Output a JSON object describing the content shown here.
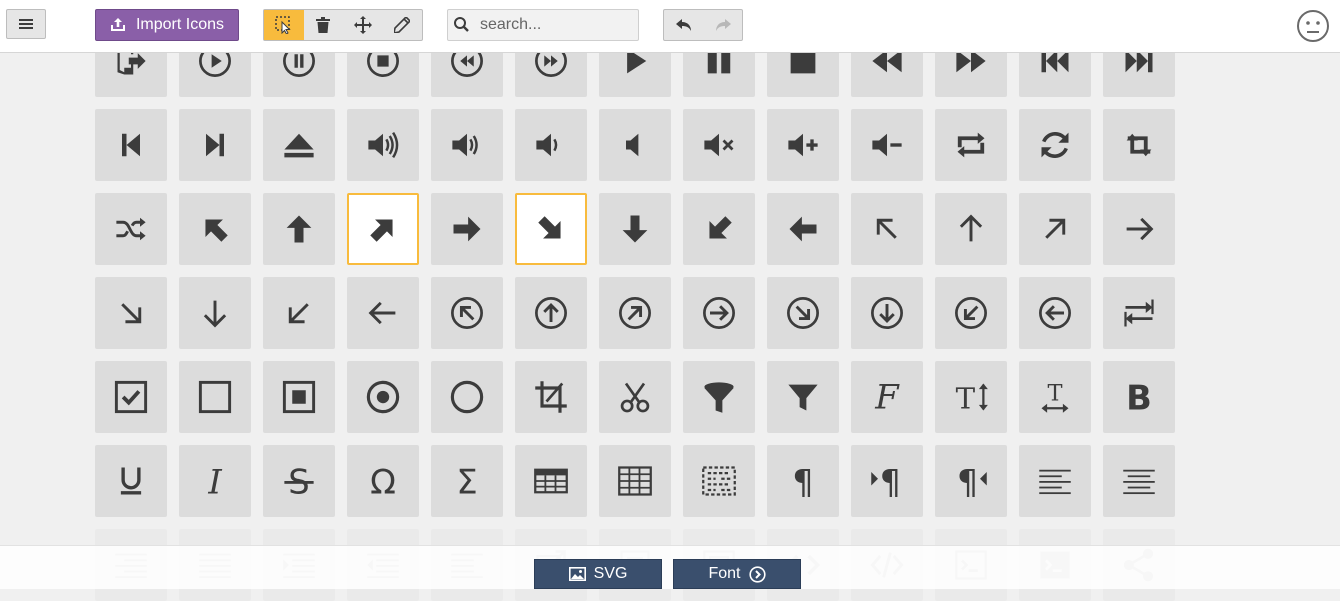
{
  "toolbar": {
    "import_label": "Import Icons",
    "search_placeholder": "search...",
    "menu_icon": "hamburger-icon",
    "tools": [
      "select-icon",
      "trash-icon",
      "move-icon",
      "pencil-icon"
    ],
    "undo_icons": [
      "undo-icon",
      "redo-icon"
    ],
    "status_icon": "neutral-face-icon"
  },
  "colors": {
    "accent": "#f8bb3d",
    "import": "#8a5fa8",
    "download": "#3a4f6d",
    "tile": "#dcdcdc",
    "glyph": "#3c3c3c"
  },
  "icons": [
    [
      "exit-icon",
      "play-circle-icon",
      "pause-circle-icon",
      "stop-circle-icon",
      "backward-circle-icon",
      "forward-circle-icon",
      "play-icon",
      "pause-icon",
      "stop-icon",
      "backward-icon",
      "forward-icon",
      "first-icon",
      "last-icon"
    ],
    [
      "previous-icon",
      "next-icon",
      "eject-icon",
      "volume-high-icon",
      "volume-medium-icon",
      "volume-low-icon",
      "volume-mute-icon",
      "volume-mute2-icon",
      "volume-increase-icon",
      "volume-decrease-icon",
      "loop-icon",
      "loop2-icon",
      "infinite-icon"
    ],
    [
      "shuffle-icon",
      "arrow-up-left-icon",
      "arrow-up-icon",
      "arrow-up-right-icon",
      "arrow-right-icon",
      "arrow-down-right-icon",
      "arrow-down-icon",
      "arrow-down-left-icon",
      "arrow-left-icon",
      "arrow-up-left2-icon",
      "arrow-up2-icon",
      "arrow-up-right2-icon",
      "arrow-right2-icon"
    ],
    [
      "arrow-down-right2-icon",
      "arrow-down2-icon",
      "arrow-down-left2-icon",
      "arrow-left2-icon",
      "circle-up-left-icon",
      "circle-up-icon",
      "circle-up-right-icon",
      "circle-right-icon",
      "circle-down-right-icon",
      "circle-down-icon",
      "circle-down-left-icon",
      "circle-left-icon",
      "tab-icon"
    ],
    [
      "checkbox-checked-icon",
      "checkbox-unchecked-icon",
      "radio-checked-icon",
      "radio-checked2-icon",
      "radio-unchecked-icon",
      "crop-icon",
      "scissors-icon",
      "filter-icon",
      "filter2-icon",
      "font-icon",
      "text-height-icon",
      "text-width-icon",
      "bold-icon"
    ],
    [
      "underline-icon",
      "italic-icon",
      "strikethrough-icon",
      "omega-icon",
      "sigma-icon",
      "table-icon",
      "table2-icon",
      "insert-template-icon",
      "pilcrow-icon",
      "ltr-icon",
      "rtl-icon",
      "paragraph-left-icon",
      "paragraph-center-icon"
    ],
    [
      "paragraph-right-icon",
      "paragraph-justify-icon",
      "indent-increase-icon",
      "indent-decrease-icon",
      "indent-right-icon",
      "share-small-icon",
      "new-tab-icon",
      "embed-frame-icon",
      "html-icon",
      "embed-icon",
      "embed2-icon",
      "terminal-icon",
      "share-icon"
    ]
  ],
  "selected": [
    "arrow-up-right-icon",
    "arrow-down-right-icon"
  ],
  "footer": {
    "svg_label": "SVG",
    "font_label": "Font",
    "svg_icon": "image-icon",
    "font_icon": "circle-right-icon"
  }
}
